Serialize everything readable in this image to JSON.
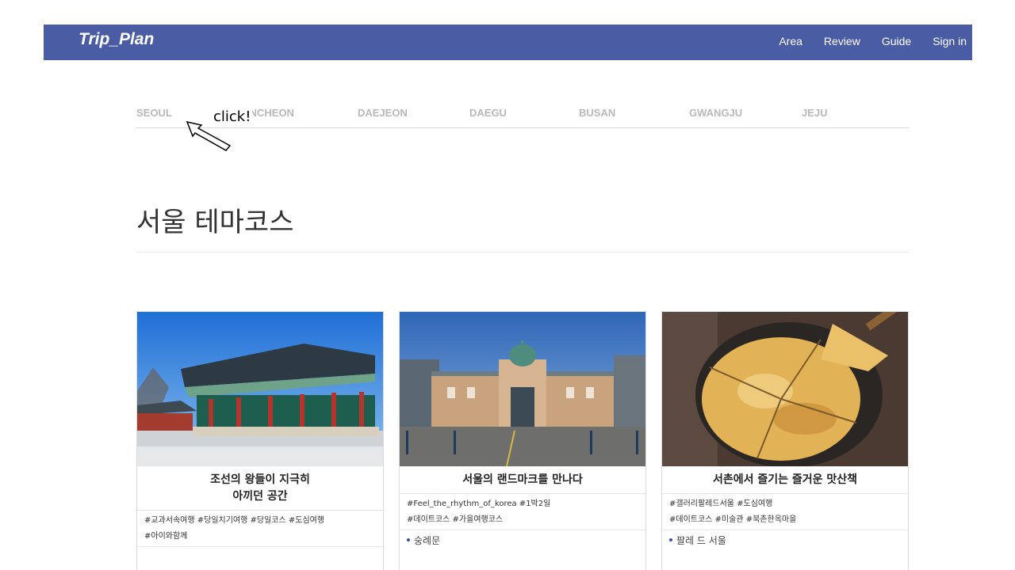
{
  "navbar": {
    "brand": "Trip_Plan",
    "links": [
      "Area",
      "Review",
      "Guide",
      "Sign in"
    ]
  },
  "regions": [
    "SEOUL",
    "INCHEON",
    "DAEJEON",
    "DAEGU",
    "BUSAN",
    "GWANGJU",
    "JEJU"
  ],
  "annotation": {
    "text": "click!"
  },
  "section_title": "서울 테마코스",
  "cards": [
    {
      "title_line1": "조선의 왕들이 지극히",
      "title_line2": "아끼던 공간",
      "tags_line1": "#교과서속여행  #당일치기여행  #당일코스  #도심여행",
      "tags_line2": "#아이와함께",
      "place": ""
    },
    {
      "title_line1": "서울의 랜드마크를 만나다",
      "title_line2": "",
      "tags_line1": "#Feel_the_rhythm_of_korea  #1박2일",
      "tags_line2": "#데이트코스  #가을여행코스",
      "place": "숭례문"
    },
    {
      "title_line1": "서촌에서 즐기는 즐거운 맛산책",
      "title_line2": "",
      "tags_line1": "#갤러리팔레드서울  #도심여행",
      "tags_line2": "#데이트코스  #미술관  #북촌한옥마을",
      "place": "팔레 드 서울"
    }
  ],
  "colors": {
    "navbar": "#4a5ca3",
    "region_text": "#b8b8b8",
    "bullet": "#3a4fa0"
  }
}
